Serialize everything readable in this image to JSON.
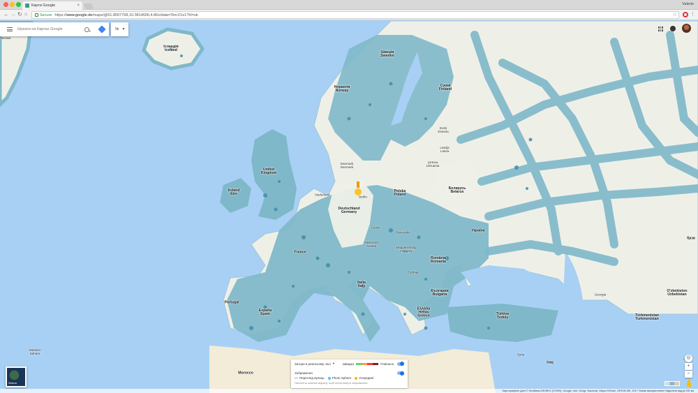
{
  "browser": {
    "tab_title": "Карти Google",
    "tab_close": "×",
    "profile": "Valerie",
    "secure_label": "Secure",
    "url_prefix": "https://",
    "url_host": "www.google.de",
    "url_rest": "/maps/@61.8007768,10.3814606,4.86z/data=!5m1!1e1?hl=uk"
  },
  "search": {
    "placeholder": "Шукати на Картах Google",
    "language": "Ук"
  },
  "map_labels": {
    "iceland": "Ісландія\nIceland",
    "sweden": "Швеція\nSweden",
    "norway": "Норвегія\nNorway",
    "finland": "Суомі\nFinland",
    "estonia": "Eesti\nEstonia",
    "latvia": "Latvija\nLatvia",
    "lithuania": "Lietuva\nLithuania",
    "denmark": "Danmark\nDenmark",
    "uk": "United\nKingdom",
    "ireland": "Ireland\nÉire",
    "netherlands": "Nederland",
    "germany": "Deutschland\nGermany",
    "poland": "Polska\nPoland",
    "belarus": "Беларусь\nBelarus",
    "ukraine": "Україна",
    "czech": "Česko",
    "slovakia": "Slovensko",
    "austria": "Österreich\nAustria",
    "hungary": "Magyarország\nHungary",
    "france": "France",
    "romania": "România\nRomania",
    "serbia": "Србија",
    "bulgaria": "България\nBulgaria",
    "italy": "Italia\nItaly",
    "spain": "España\nSpain",
    "portugal": "Portugal",
    "greece": "Ελλάδα\nHellas\nGreece",
    "turkey": "Türkiye\nTurkey",
    "morocco": "Morocco",
    "western_sahara": "Western\nSahara",
    "kazakhstan": "Қаза",
    "uzbekistan": "O'zbekiston\nUzbekistan",
    "turkmenistan": "Türkmenistan\nTurkmenistan",
    "georgia": "Georgia",
    "afghanistan": "Afgha",
    "iraq": "Iraq",
    "syria": "Syria",
    "greenland": "Kalaallit\nNunaat",
    "berlin": "Berlin"
  },
  "layers_panel": {
    "traffic_label": "Затори в реальному часі",
    "fast": "Швидко",
    "slow": "Повільно",
    "imagery_label": "Зображення",
    "street_view": "Перегляд вулиць",
    "photo_sphere": "Photo Sphere",
    "inside": "Усередині",
    "hint": "Натисніть жовтий маркер, щоб переглянути зображення"
  },
  "earth_label": "Земля",
  "zoom_in": "+",
  "zoom_out": "−",
  "footer": "Картографічні дані © GeoBasis-DE/BKG (©2009), Google, Inst. Geogr. Nacional, Mapa GISrael, ORION-ME, 2017   Умови використання   Надіслати відгук   200 км",
  "colors": {
    "water": "#a8d0f5",
    "land": "#eef0e8",
    "coverage": "#7fb8c9",
    "coverage_dot": "#3f8da6"
  }
}
